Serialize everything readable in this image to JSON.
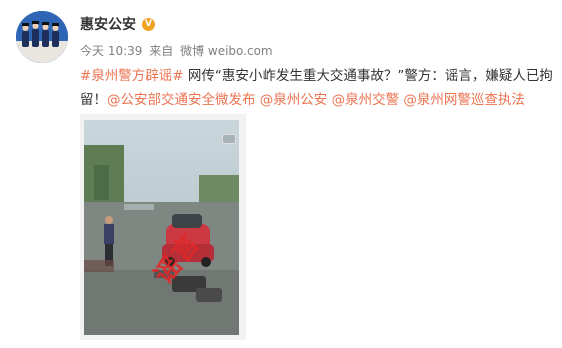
{
  "user": {
    "name": "惠安公安",
    "badge": "V"
  },
  "meta": {
    "time": "今天 10:39",
    "source_prefix": "来自",
    "source": "微博 weibo.com"
  },
  "post": {
    "hashtag": "#泉州警方辟谣#",
    "text_line1": "网传“惠安小岞发生重大交通事故？”警方：谣言，嫌疑人已拘",
    "text_line2_start": "留！",
    "mentions": [
      "@公安部交通安全微发布",
      "@泉州公安",
      "@泉州交警",
      "@泉州网警巡查执法"
    ]
  },
  "media": {
    "stamp_text": "谣言"
  }
}
